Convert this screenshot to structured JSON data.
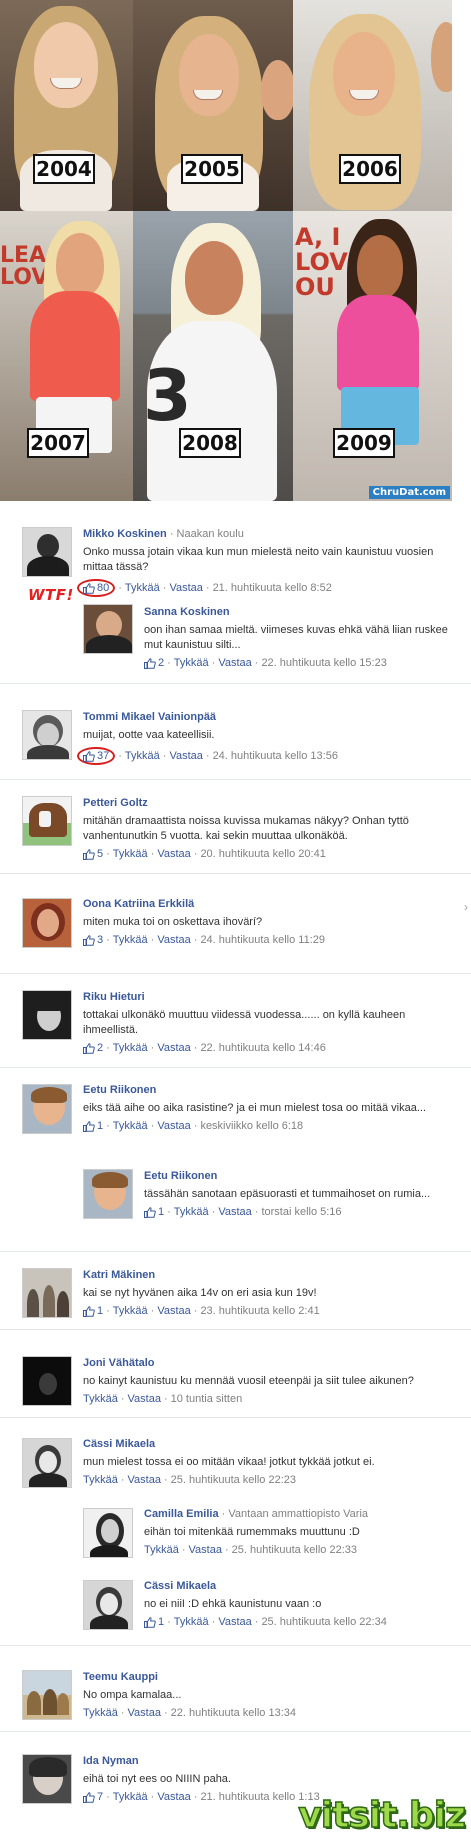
{
  "collage": {
    "years": [
      "2004",
      "2005",
      "2006",
      "2007",
      "2008",
      "2009"
    ],
    "sign_2007": "LEA\nLOV",
    "sign_2009": "A, I\nLOVE\nOU",
    "jersey_number": "3",
    "source": "ChruDat.com"
  },
  "annotation": {
    "wtf": "WTF!"
  },
  "comments": [
    {
      "name": "Mikko Koskinen",
      "affiliation": "Naakan koulu",
      "text": "Onko mussa jotain vikaa kun mun mielestä neito vain kaunistuu vuosien mittaa tässä?",
      "likes": "80",
      "like_label": "Tykkää",
      "reply_label": "Vastaa",
      "time": "21. huhtikuuta kello 8:52"
    },
    {
      "name": "Sanna Koskinen",
      "affiliation": "",
      "text": "oon ihan samaa mieltä. viimeses kuvas ehkä vähä liian ruskee mut kaunistuu silti...",
      "likes": "2",
      "like_label": "Tykkää",
      "reply_label": "Vastaa",
      "time": "22. huhtikuuta kello 15:23"
    },
    {
      "name": "Tommi Mikael Vainionpää",
      "affiliation": "",
      "text": "muijat, ootte vaa kateellisii.",
      "likes": "37",
      "like_label": "Tykkää",
      "reply_label": "Vastaa",
      "time": "24. huhtikuuta kello 13:56"
    },
    {
      "name": "Petteri Goltz",
      "affiliation": "",
      "text": "mitähän dramaattista noissa kuvissa mukamas näkyy? Onhan tyttö vanhentunutkin 5 vuotta. kai sekin muuttaa ulkonäköä.",
      "likes": "5",
      "like_label": "Tykkää",
      "reply_label": "Vastaa",
      "time": "20. huhtikuuta kello 20:41"
    },
    {
      "name": "Oona Katriina Erkkilä",
      "affiliation": "",
      "text": "miten muka toi on oskettava ihovärí?",
      "likes": "3",
      "like_label": "Tykkää",
      "reply_label": "Vastaa",
      "time": "24. huhtikuuta kello 11:29"
    },
    {
      "name": "Riku Hieturi",
      "affiliation": "",
      "text": "tottakai ulkonäkö muuttuu viidessä vuodessa...... on kyllä kauheen ihmeellistä.",
      "likes": "2",
      "like_label": "Tykkää",
      "reply_label": "Vastaa",
      "time": "22. huhtikuuta kello 14:46"
    },
    {
      "name": "Eetu Riikonen",
      "affiliation": "",
      "text": "eiks tää aihe oo aika rasistine? ja ei mun mielest tosa oo mitää vikaa...",
      "likes": "1",
      "like_label": "Tykkää",
      "reply_label": "Vastaa",
      "time": "keskiviikko kello 6:18"
    },
    {
      "name": "Eetu Riikonen",
      "affiliation": "",
      "text": "tässähän sanotaan epäsuorasti et tummaihoset on rumia...",
      "likes": "1",
      "like_label": "Tykkää",
      "reply_label": "Vastaa",
      "time": "torstai kello 5:16"
    },
    {
      "name": "Katri Mäkinen",
      "affiliation": "",
      "text": "kai se nyt hyvänen aika 14v on eri asia kun 19v!",
      "likes": "1",
      "like_label": "Tykkää",
      "reply_label": "Vastaa",
      "time": "23. huhtikuuta kello 2:41"
    },
    {
      "name": "Joni Vähätalo",
      "affiliation": "",
      "text": "no kainyt kaunistuu ku mennää vuosil eteenpäi ja siit tulee aikunen?",
      "likes": "",
      "like_label": "Tykkää",
      "reply_label": "Vastaa",
      "time": "10 tuntia sitten"
    },
    {
      "name": "Cässi Mikaela",
      "affiliation": "",
      "text": "mun mielest tossa ei oo mitään vikaa! jotkut tykkää jotkut ei.",
      "likes": "",
      "like_label": "Tykkää",
      "reply_label": "Vastaa",
      "time": "25. huhtikuuta kello 22:23"
    },
    {
      "name": "Camilla Emilia",
      "affiliation": "Vantaan ammattiopisto Varia",
      "text": "eihän toi mitenkää rumemmaks muuttunu :D",
      "likes": "",
      "like_label": "Tykkää",
      "reply_label": "Vastaa",
      "time": "25. huhtikuuta kello 22:33"
    },
    {
      "name": "Cässi Mikaela",
      "affiliation": "",
      "text": "no ei niiI :D ehkä kaunistunu vaan :o",
      "likes": "1",
      "like_label": "Tykkää",
      "reply_label": "Vastaa",
      "time": "25. huhtikuuta kello 22:34"
    },
    {
      "name": "Teemu Kauppi",
      "affiliation": "",
      "text": "No ompa kamalaa...",
      "likes": "",
      "like_label": "Tykkää",
      "reply_label": "Vastaa",
      "time": "22. huhtikuuta kello 13:34"
    },
    {
      "name": "Ida Nyman",
      "affiliation": "",
      "text": "eihä toi nyt ees oo NIIIN paha.",
      "likes": "7",
      "like_label": "Tykkää",
      "reply_label": "Vastaa",
      "time": "21. huhtikuuta kello 1:13"
    }
  ],
  "watermark": "vitsit.biz",
  "colors": {
    "link": "#3b5998",
    "meta": "#808080",
    "highlight": "#d81d1d",
    "watermark": "#9fd84a"
  }
}
